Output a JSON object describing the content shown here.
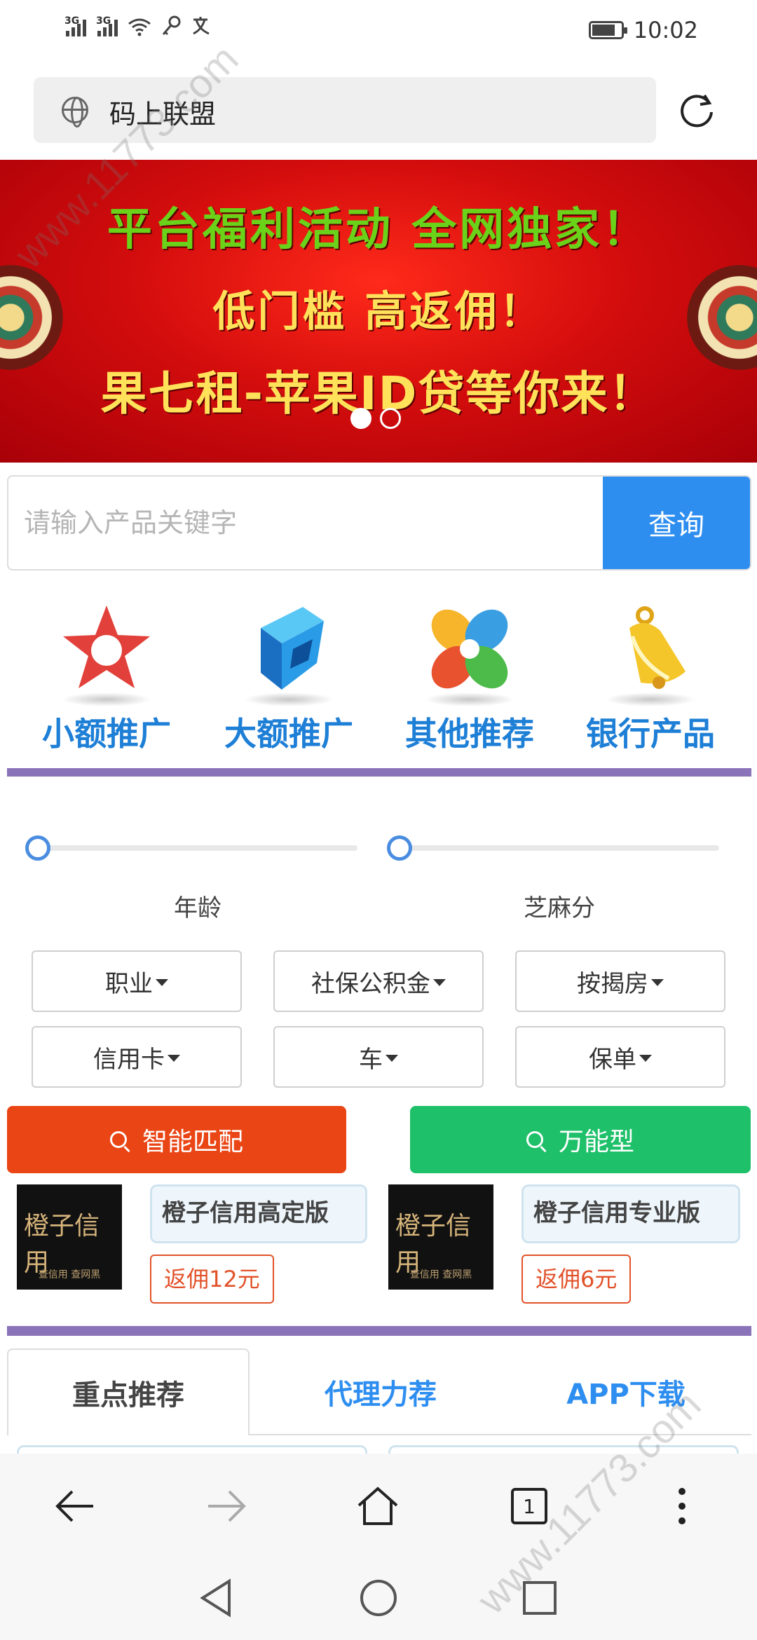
{
  "status_bar": {
    "signal_1": "3G",
    "signal_2": "3G",
    "time": "10:02",
    "icons": [
      "signal-icon",
      "signal-icon",
      "wifi-icon",
      "key-icon",
      "translate-icon",
      "battery-icon"
    ]
  },
  "address_bar": {
    "site_title": "码上联盟",
    "icons": [
      "globe-icon",
      "reload-icon"
    ]
  },
  "banner": {
    "line1": "平台福利活动  全网独家！",
    "line2": "低门槛  高返佣！",
    "line3": "果七租-苹果ID贷等你来！",
    "slide_count": 2,
    "active_slide": 1,
    "colors": {
      "line1": "#6bd21a",
      "line2": "#ffe25a",
      "bg": "#d40d0d"
    }
  },
  "search": {
    "placeholder": "请输入产品关键字",
    "value": "",
    "button_label": "查询"
  },
  "categories": [
    {
      "label": "小额推广",
      "icon": "red-star-icon"
    },
    {
      "label": "大额推广",
      "icon": "blue-cube-icon"
    },
    {
      "label": "其他推荐",
      "icon": "colorful-flower-icon"
    },
    {
      "label": "银行产品",
      "icon": "golden-bell-icon"
    }
  ],
  "filters": {
    "sliders": [
      {
        "label": "年龄",
        "value": 0
      },
      {
        "label": "芝麻分",
        "value": 0
      }
    ],
    "dropdowns": [
      {
        "label": "职业"
      },
      {
        "label": "社保公积金"
      },
      {
        "label": "按揭房"
      },
      {
        "label": "信用卡"
      },
      {
        "label": "车"
      },
      {
        "label": "保单"
      }
    ]
  },
  "match_buttons": {
    "smart_label": "智能匹配",
    "universal_label": "万能型",
    "colors": {
      "smart": "#ea4515",
      "universal": "#1ec06a"
    }
  },
  "products": [
    {
      "logo_text": "橙子信用",
      "logo_sub": "查信用 查网黑",
      "name": "橙子信用高定版",
      "rebate": "返佣12元"
    },
    {
      "logo_text": "橙子信用",
      "logo_sub": "查信用 查网黑",
      "name": "橙子信用专业版",
      "rebate": "返佣6元"
    }
  ],
  "tabs": [
    {
      "label": "重点推荐",
      "active": true
    },
    {
      "label": "代理力荐",
      "active": false
    },
    {
      "label": "APP下载",
      "active": false
    }
  ],
  "browser_toolbar": {
    "tab_count": "1",
    "icons": [
      "back-arrow-icon",
      "forward-arrow-icon",
      "home-icon",
      "tabs-icon",
      "more-vertical-icon"
    ]
  },
  "system_nav": {
    "icons": [
      "nav-back-icon",
      "nav-home-icon",
      "nav-recents-icon"
    ]
  },
  "watermark": {
    "text_top": "www.11773.com",
    "text_bottom": "www.11773.com"
  },
  "accent_colors": {
    "primary_blue": "#2e8ef0",
    "category_blue": "#1e7fd6",
    "divider_purple": "#8a73b8",
    "rebate_red": "#e2522a"
  }
}
